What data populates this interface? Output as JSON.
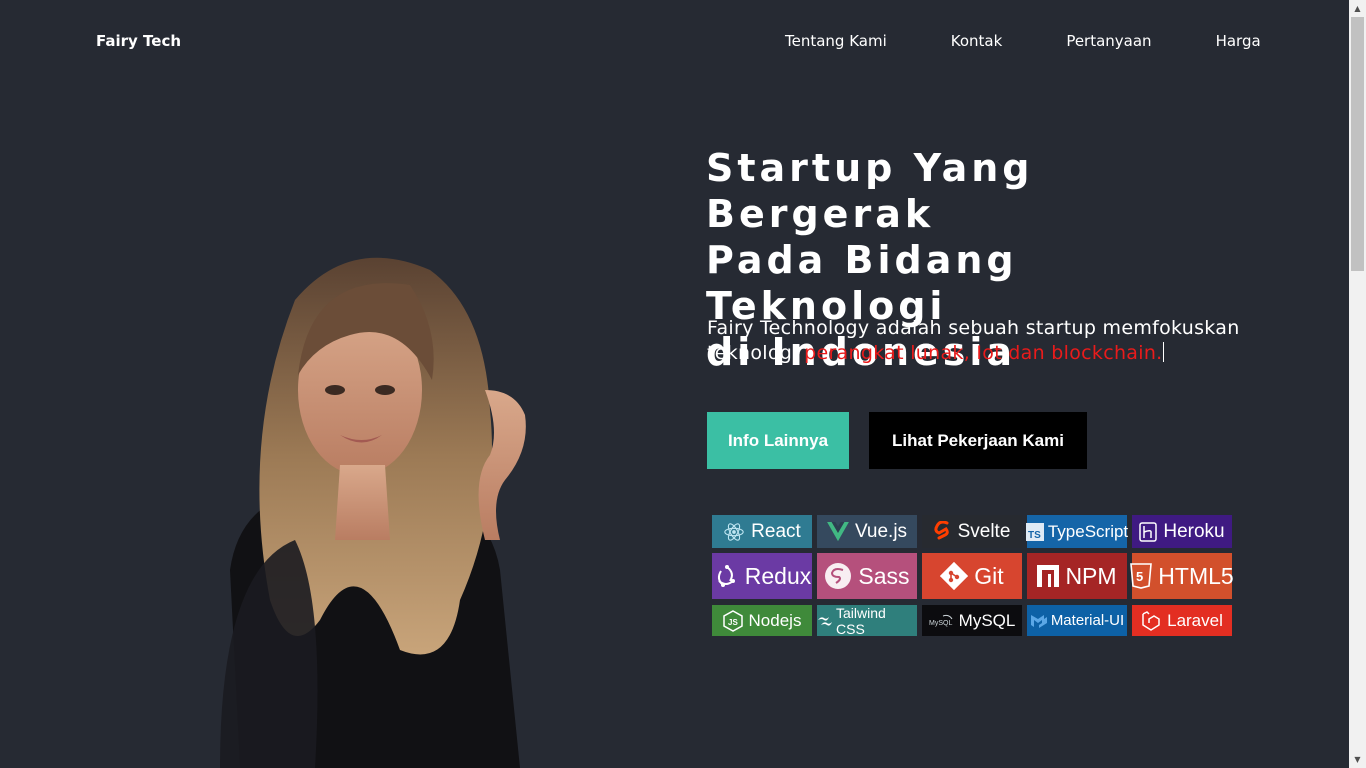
{
  "nav": {
    "brand": "Fairy Tech",
    "links": [
      "Tentang Kami",
      "Kontak",
      "Pertanyaan",
      "Harga"
    ]
  },
  "hero": {
    "headline_lines": [
      "Startup Yang Bergerak",
      "Pada Bidang Teknologi",
      "di Indonesia"
    ],
    "description": "Fairy Technology adalah sebuah startup memfokuskan teknologi ",
    "description_highlight": "perangkat lunak, Iot dan blockchain.",
    "primary_button": "Info Lainnya",
    "secondary_button": "Lihat Pekerjaan Kami"
  },
  "badges": [
    {
      "label": "React",
      "color": "#2f7b92",
      "icon": "react-icon"
    },
    {
      "label": "Vue.js",
      "color": "#35495e",
      "icon": "vue-icon"
    },
    {
      "label": "Svelte",
      "color": "#272a30",
      "icon": "svelte-icon"
    },
    {
      "label": "TypeScript",
      "color": "#1565a8",
      "icon": "typescript-icon"
    },
    {
      "label": "Heroku",
      "color": "#3f1a82",
      "icon": "heroku-icon"
    },
    {
      "label": "Redux",
      "color": "#6b3aa4",
      "icon": "redux-icon"
    },
    {
      "label": "Sass",
      "color": "#b5507c",
      "icon": "sass-icon"
    },
    {
      "label": "Git",
      "color": "#d7452f",
      "icon": "git-icon"
    },
    {
      "label": "NPM",
      "color": "#a52525",
      "icon": "npm-icon"
    },
    {
      "label": "HTML5",
      "color": "#d2502c",
      "icon": "html5-icon"
    },
    {
      "label": "Nodejs",
      "color": "#3f8a3a",
      "icon": "nodejs-icon"
    },
    {
      "label": "Tailwind CSS",
      "color": "#2f7f7c",
      "icon": "tailwind-icon"
    },
    {
      "label": "MySQL",
      "color": "#0c0c0f",
      "icon": "mysql-icon"
    },
    {
      "label": "Material-UI",
      "color": "#0d61a6",
      "icon": "material-ui-icon"
    },
    {
      "label": "Laravel",
      "color": "#e32e22",
      "icon": "laravel-icon"
    }
  ]
}
